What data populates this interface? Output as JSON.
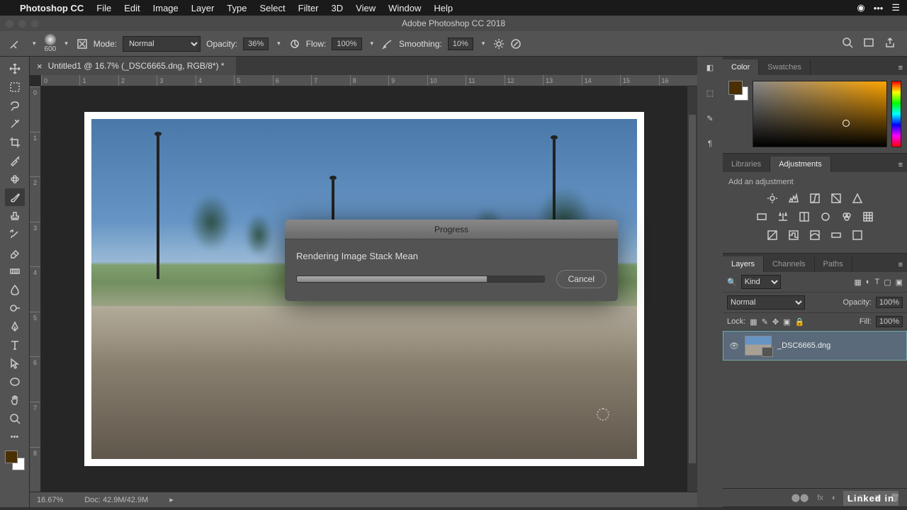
{
  "menubar": {
    "app": "Photoshop CC",
    "items": [
      "File",
      "Edit",
      "Image",
      "Layer",
      "Type",
      "Select",
      "Filter",
      "3D",
      "View",
      "Window",
      "Help"
    ]
  },
  "window": {
    "title": "Adobe Photoshop CC 2018"
  },
  "options": {
    "brush_size": "600",
    "mode_label": "Mode:",
    "mode_value": "Normal",
    "opacity_label": "Opacity:",
    "opacity_value": "36%",
    "flow_label": "Flow:",
    "flow_value": "100%",
    "smoothing_label": "Smoothing:",
    "smoothing_value": "10%"
  },
  "document": {
    "tab_title": "Untitled1 @ 16.7% (_DSC6665.dng, RGB/8*) *",
    "ruler_h": [
      "0",
      "1",
      "2",
      "3",
      "4",
      "5",
      "6",
      "7",
      "8",
      "9",
      "10",
      "11",
      "12",
      "13",
      "14",
      "15",
      "16"
    ],
    "ruler_v": [
      "0",
      "1",
      "2",
      "3",
      "4",
      "5",
      "6",
      "7",
      "8"
    ]
  },
  "dialog": {
    "title": "Progress",
    "message": "Rendering Image Stack Mean",
    "cancel": "Cancel"
  },
  "status": {
    "zoom": "16.67%",
    "doc": "Doc: 42.9M/42.9M"
  },
  "panels": {
    "color": {
      "tab1": "Color",
      "tab2": "Swatches"
    },
    "lib": {
      "tab1": "Libraries",
      "tab2": "Adjustments",
      "add": "Add an adjustment"
    },
    "layers": {
      "tab1": "Layers",
      "tab2": "Channels",
      "tab3": "Paths",
      "kind": "Kind",
      "blend": "Normal",
      "opacity_label": "Opacity:",
      "opacity": "100%",
      "lock": "Lock:",
      "fill_label": "Fill:",
      "fill": "100%",
      "layer_name": "_DSC6665.dng"
    }
  },
  "branding": {
    "linkedin": "Linked in"
  }
}
